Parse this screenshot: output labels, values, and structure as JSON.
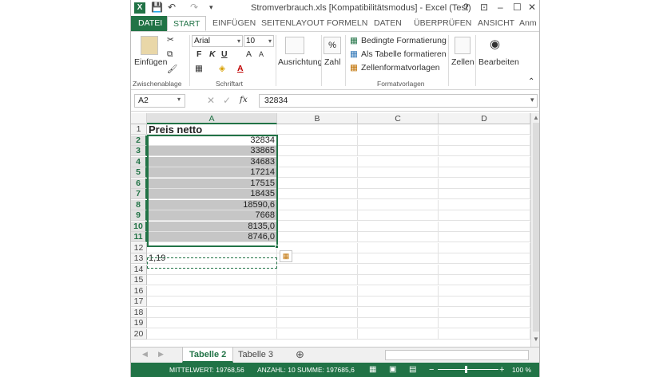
{
  "window": {
    "title": "Stromverbrauch.xls  [Kompatibilitätsmodus] - Excel (Test)",
    "app_icon": "X",
    "controls": [
      "?",
      "⊡",
      "–",
      "☐",
      "✕"
    ]
  },
  "ribbon_tabs": [
    "DATEI",
    "START",
    "EINFÜGEN",
    "SEITENLAYOUT",
    "FORMELN",
    "DATEN",
    "ÜBERPRÜFEN",
    "ANSICHT",
    "Anm"
  ],
  "ribbon": {
    "clipboard": {
      "paste_label": "Einfügen",
      "group_label": "Zwischenablage"
    },
    "font": {
      "font_name": "Arial",
      "font_size": "10",
      "bold": "F",
      "italic": "K",
      "underline": "U",
      "grow": "A",
      "shrink": "A",
      "group_label": "Schriftart"
    },
    "alignment": {
      "label": "Ausrichtung"
    },
    "number": {
      "label": "Zahl",
      "icon_text": "%"
    },
    "styles": {
      "conditional": "Bedingte Formatierung",
      "as_table": "Als Tabelle formatieren",
      "cell_styles": "Zellenformatvorlagen",
      "group_label": "Formatvorlagen"
    },
    "cells": {
      "label": "Zellen"
    },
    "editing": {
      "label": "Bearbeiten"
    }
  },
  "formula_bar": {
    "name_box": "A2",
    "fx": "fx",
    "value": "32834"
  },
  "sheet": {
    "columns": [
      "A",
      "B",
      "C",
      "D"
    ],
    "rows": [
      {
        "n": "1",
        "a": "Preis netto"
      },
      {
        "n": "2",
        "a": "32834"
      },
      {
        "n": "3",
        "a": "33865"
      },
      {
        "n": "4",
        "a": "34683"
      },
      {
        "n": "5",
        "a": "17214"
      },
      {
        "n": "6",
        "a": "17515"
      },
      {
        "n": "7",
        "a": "18435"
      },
      {
        "n": "8",
        "a": "18590,6"
      },
      {
        "n": "9",
        "a": "7668"
      },
      {
        "n": "10",
        "a": "8135,0"
      },
      {
        "n": "11",
        "a": "8746,0"
      },
      {
        "n": "12",
        "a": ""
      },
      {
        "n": "13",
        "a": "1,19"
      },
      {
        "n": "14",
        "a": ""
      },
      {
        "n": "15",
        "a": ""
      },
      {
        "n": "16",
        "a": ""
      },
      {
        "n": "17",
        "a": ""
      },
      {
        "n": "18",
        "a": ""
      },
      {
        "n": "19",
        "a": ""
      },
      {
        "n": "20",
        "a": ""
      }
    ]
  },
  "sheet_tabs": [
    "Tabelle 2",
    "Tabelle 3"
  ],
  "status_bar": {
    "mittelwert": "MITTELWERT: 19768,56",
    "anzahl": "ANZAHL: 10",
    "summe": "SUMME: 197685,6",
    "zoom": "100 %"
  },
  "colors": {
    "accent": "#217346",
    "selection": "#c6c6c6"
  }
}
